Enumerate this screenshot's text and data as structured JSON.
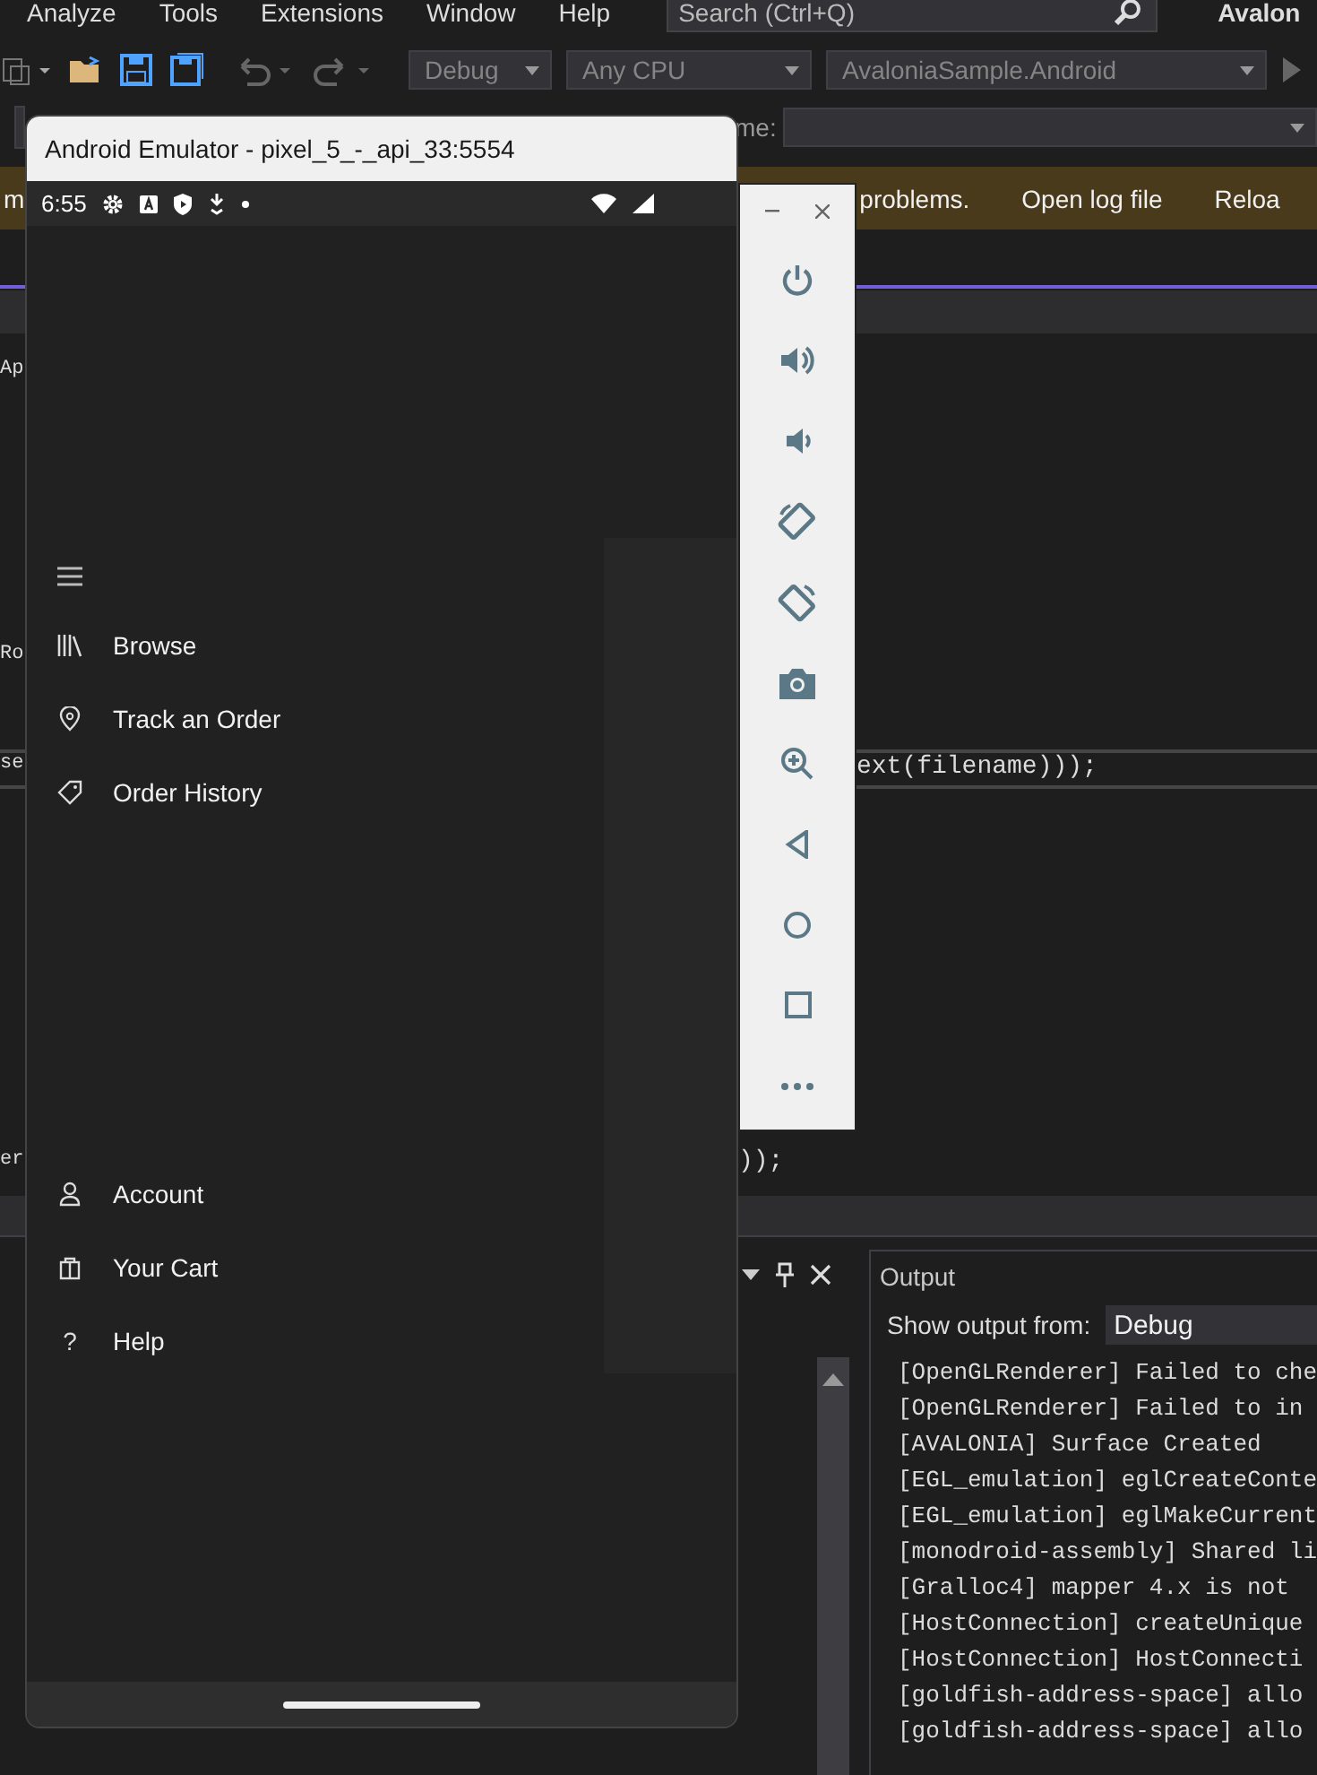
{
  "ide": {
    "menu": [
      "Analyze",
      "Tools",
      "Extensions",
      "Window",
      "Help"
    ],
    "search": {
      "placeholder": "Search (Ctrl+Q)"
    },
    "title": "Avalon",
    "toolbar": {
      "configuration": "Debug",
      "platform": "Any CPU",
      "startup_project": "AvaloniaSample.Android",
      "field_label": "me:"
    },
    "info_bar": {
      "fragment": "m",
      "message": "problems.",
      "actions": [
        "Open log file",
        "Reloa"
      ]
    },
    "code_left": [
      "Ap",
      "Ro",
      "se",
      "er"
    ],
    "code_right": [
      "ext(filename)));",
      "));"
    ],
    "output": {
      "title": "Output",
      "source_label": "Show output from:",
      "source": "Debug",
      "lines": [
        "[OpenGLRenderer] Failed to che",
        "[OpenGLRenderer] Failed to in",
        "[AVALONIA] Surface Created",
        "[EGL_emulation] eglCreateConte",
        "[EGL_emulation] eglMakeCurrent",
        "[monodroid-assembly] Shared li",
        "[Gralloc4] mapper 4.x is not",
        "[HostConnection] createUnique",
        "[HostConnection] HostConnecti",
        "[goldfish-address-space] allo",
        "[goldfish-address-space] allo"
      ]
    }
  },
  "emulator": {
    "title": "Android Emulator - pixel_5_-_api_33:5554",
    "status_time": "6:55",
    "menu_top": [
      {
        "label": "Browse"
      },
      {
        "label": "Track an Order"
      },
      {
        "label": "Order History"
      }
    ],
    "menu_bottom": [
      {
        "label": "Account"
      },
      {
        "label": "Your Cart"
      },
      {
        "label": "Help",
        "glyph": "?"
      }
    ]
  }
}
